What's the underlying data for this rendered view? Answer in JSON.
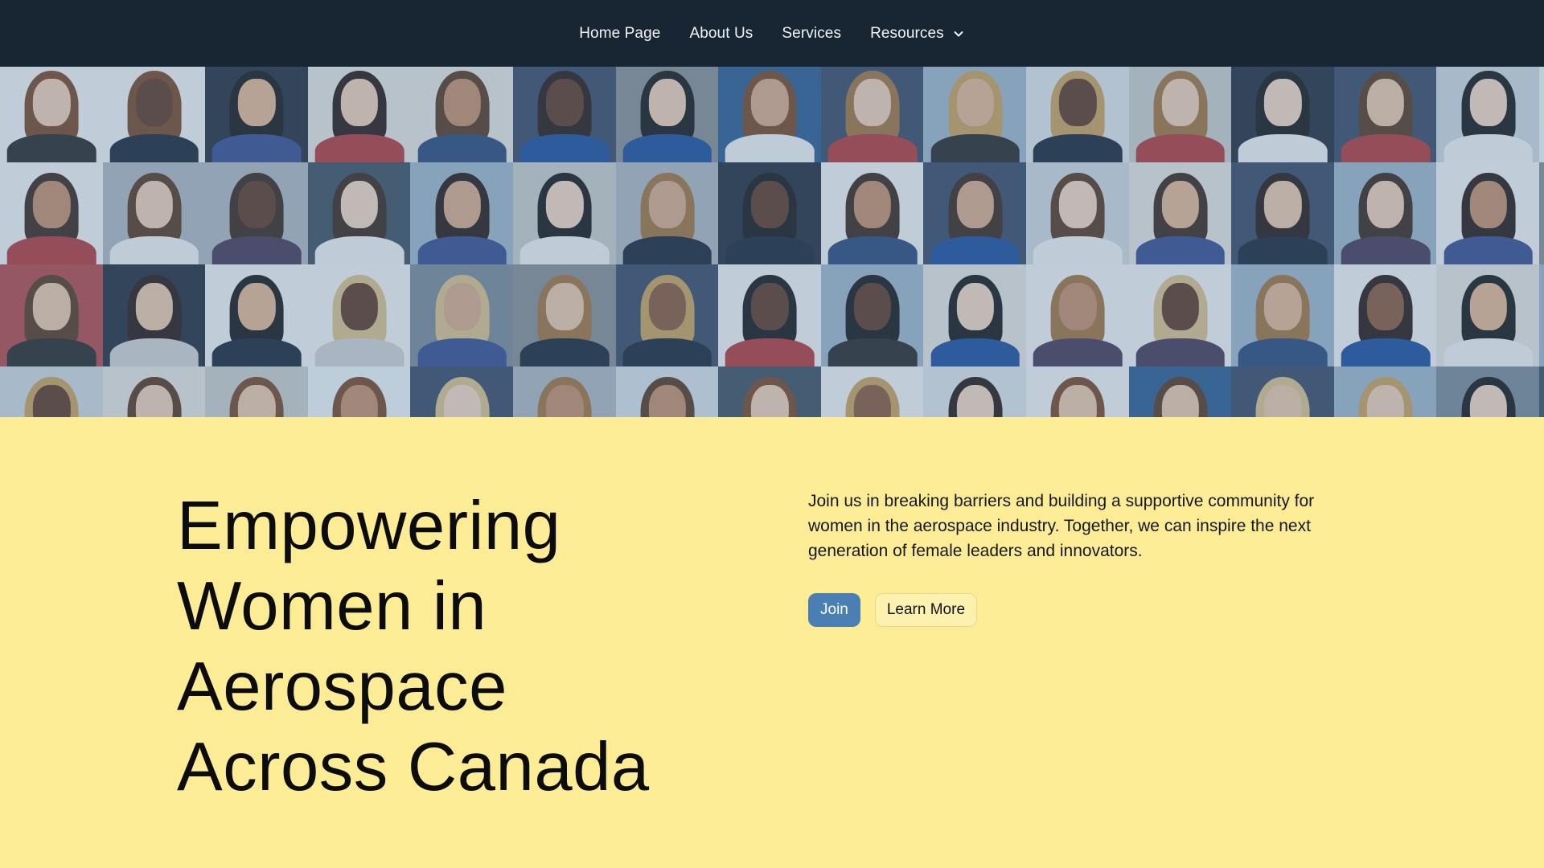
{
  "nav": {
    "items": [
      {
        "label": "Home Page"
      },
      {
        "label": "About Us"
      },
      {
        "label": "Services"
      },
      {
        "label": "Resources",
        "has_dropdown": true
      }
    ],
    "dropdown_icon": "chevron-down-icon"
  },
  "hero": {
    "title_lines": [
      "Empowering",
      "Women in",
      "Aerospace",
      "Across Canada"
    ],
    "description": "Join us in breaking barriers and building a supportive community for women in the aerospace industry. Together, we can inspire the next generation of female leaders and innovators.",
    "join_label": "Join",
    "learn_more_label": "Learn More"
  },
  "colors": {
    "nav_background": "#182532",
    "hero_background": "#fdec96",
    "join_button": "#4a7fb4"
  }
}
